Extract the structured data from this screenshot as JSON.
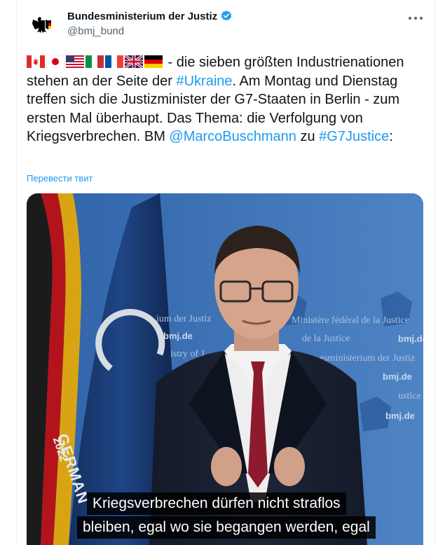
{
  "author": {
    "display_name": "Bundesministerium der Justiz",
    "handle": "@bmj_bund"
  },
  "tweet": {
    "text_after_flags": " - die sieben größten Industrienationen stehen an der Seite der ",
    "hashtag_ukraine": "#Ukraine",
    "text_middle": ". Am Montag und Dienstag treffen sich die Justizminister der G7-Staaten in Berlin - zum ersten Mal überhaupt. Das Thema: die Verfolgung von Kriegsverbrechen. BM ",
    "mention": "@MarcoBuschmann",
    "text_zu": " zu ",
    "hashtag_g7": "#G7Justice",
    "text_end": ":",
    "flags": [
      "canada-flag-icon",
      "japan-flag-icon",
      "usa-flag-icon",
      "italy-flag-icon",
      "france-flag-icon",
      "uk-flag-icon",
      "germany-flag-icon"
    ]
  },
  "translate_link": "Перевести твит",
  "video": {
    "backdrop_text": {
      "justiz_partial": "ium der Justiz",
      "justice_fr": "Ministère fédéral de la Justice",
      "bmj_left": "bmj.de",
      "bmj_right_1": "bmj.de",
      "bmj_right_2": "bmj.de",
      "bmj_right_3": "bmj.de",
      "bmj_right_4": "bmj.de",
      "istry": "istry of J",
      "justice_center": "de la Justice",
      "justiz_right": "esministerium der Justiz",
      "ustice": "ustice",
      "german": "GERMAN",
      "year": "2022"
    },
    "subtitle_line1": "Kriegsverbrechen dürfen nicht straflos",
    "subtitle_line2": "bleiben, egal wo sie begangen werden, egal"
  },
  "colors": {
    "link": "#1d9bf0",
    "secondary_text": "#536471",
    "backdrop_blue": "#3d6eb2"
  }
}
